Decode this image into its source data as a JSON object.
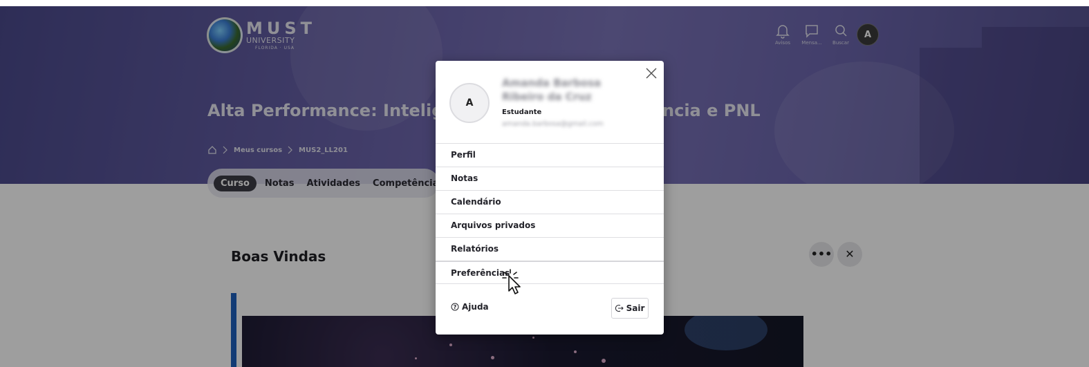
{
  "header": {
    "logo": {
      "name": "MUST",
      "sub": "UNIVERSITY",
      "location": "FLORIDA · USA"
    },
    "icons": [
      {
        "name": "bell-icon",
        "label": "Avisos"
      },
      {
        "name": "chat-icon",
        "label": "Mensa..."
      },
      {
        "name": "search-icon",
        "label": "Buscar"
      }
    ],
    "avatar_initial": "A"
  },
  "course": {
    "title_visible_left": "Alta Performance: Inteligê",
    "title_visible_right": "ncia e PNL"
  },
  "breadcrumb": {
    "items": [
      "Meus cursos",
      "MUS2_LL201"
    ]
  },
  "tabs": [
    {
      "label": "Curso",
      "active": true
    },
    {
      "label": "Notas",
      "active": false
    },
    {
      "label": "Atividades",
      "active": false
    },
    {
      "label": "Competências",
      "active": false
    }
  ],
  "section": {
    "title": "Boas Vindas",
    "more_label": "•••",
    "close_label": "✕"
  },
  "user_menu": {
    "avatar_initial": "A",
    "name": "Amanda Barbosa Ribeiro da Cruz",
    "role": "Estudante",
    "email": "amanda.barbosa@gmail.com",
    "items": [
      "Perfil",
      "Notas",
      "Calendário",
      "Arquivos privados",
      "Relatórios",
      "Preferências"
    ],
    "help_label": "Ajuda",
    "logout_label": "Sair"
  },
  "colors": {
    "hero": "#6a63aa",
    "overlay": "rgba(0,0,0,0.38)",
    "accent_bar": "#1d5fbd",
    "tab_active": "#3d3d46"
  }
}
